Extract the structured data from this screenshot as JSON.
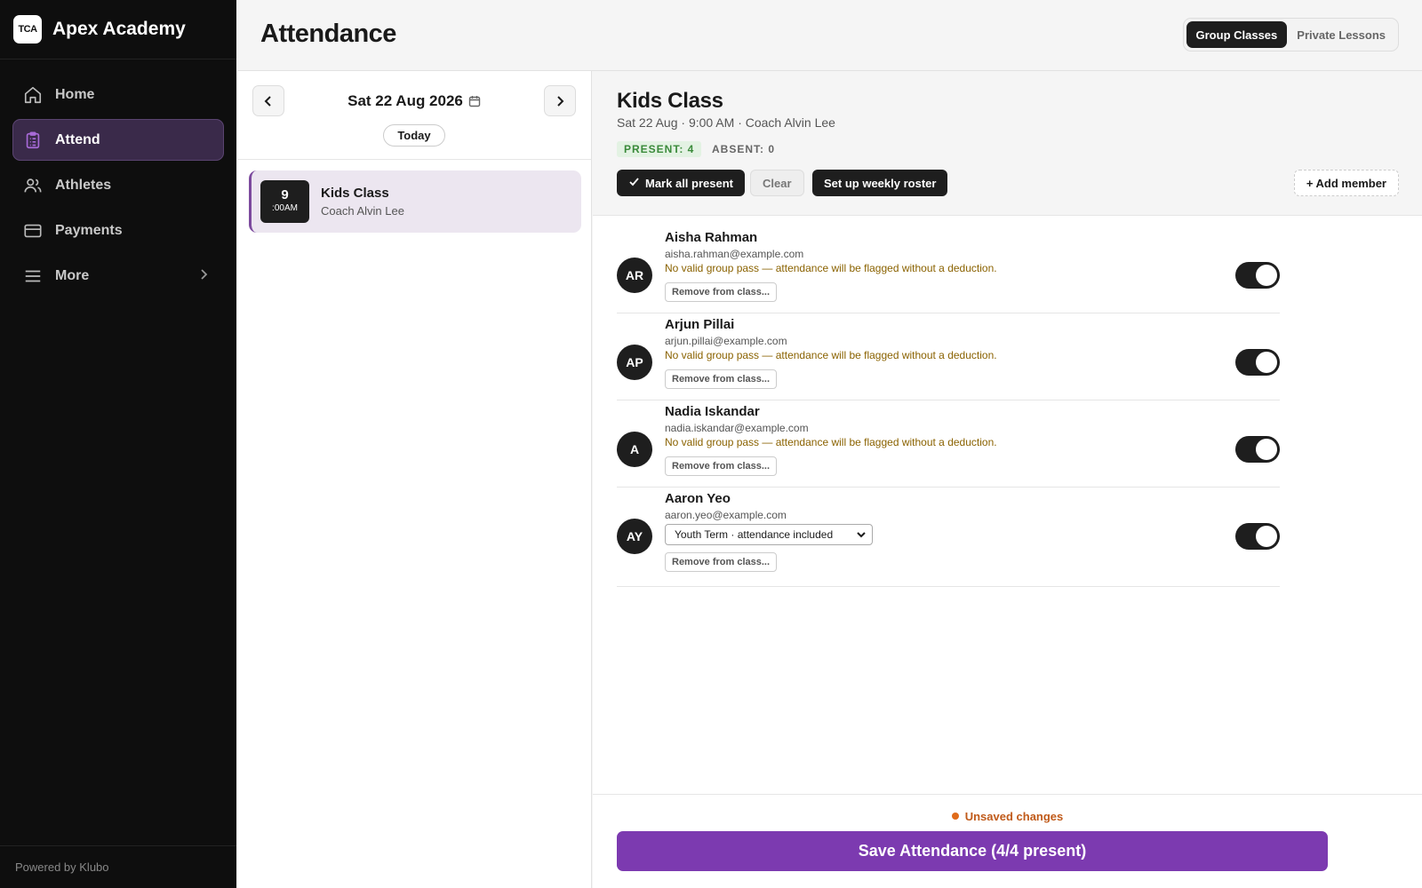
{
  "app": {
    "logo_text": "TCA",
    "name": "Apex Academy",
    "powered_by": "Powered by Klubo"
  },
  "sidebar": {
    "items": [
      {
        "label": "Home",
        "icon": "home-icon",
        "active": false
      },
      {
        "label": "Attend",
        "icon": "clipboard-icon",
        "active": true
      },
      {
        "label": "Athletes",
        "icon": "users-icon",
        "active": false
      },
      {
        "label": "Payments",
        "icon": "credit-card-icon",
        "active": false
      },
      {
        "label": "More",
        "icon": "menu-icon",
        "active": false
      }
    ]
  },
  "header": {
    "title": "Attendance",
    "tabs": [
      {
        "label": "Group Classes",
        "active": true
      },
      {
        "label": "Private Lessons",
        "active": false
      }
    ]
  },
  "schedule": {
    "date": "Sat 22 Aug 2026",
    "today_label": "Today",
    "classes": [
      {
        "hour": "9",
        "minutes": ":00AM",
        "title": "Kids Class",
        "coach": "Coach Alvin Lee"
      }
    ]
  },
  "session": {
    "title": "Kids Class",
    "meta": "Sat 22 Aug · 9:00 AM · Coach Alvin Lee",
    "present_label": "PRESENT: 4",
    "absent_label": "ABSENT: 0",
    "buttons": {
      "mark_all": "Mark all present",
      "clear": "Clear",
      "roster": "Set up weekly roster",
      "add_member": "+ Add member"
    }
  },
  "members": [
    {
      "initials": "AR",
      "name": "Aisha Rahman",
      "email": "aisha.rahman@example.com",
      "warning": "No valid group pass — attendance will be flagged without a deduction.",
      "remove_label": "Remove from class...",
      "present": true
    },
    {
      "initials": "AP",
      "name": "Arjun Pillai",
      "email": "arjun.pillai@example.com",
      "warning": "No valid group pass — attendance will be flagged without a deduction.",
      "remove_label": "Remove from class...",
      "present": true
    },
    {
      "initials": "A",
      "name": "Nadia Iskandar",
      "email": "nadia.iskandar@example.com",
      "warning": "No valid group pass — attendance will be flagged without a deduction.",
      "remove_label": "Remove from class...",
      "present": true
    },
    {
      "initials": "AY",
      "name": "Aaron Yeo",
      "email": "aaron.yeo@example.com",
      "pass_selected": "Youth Term · attendance included",
      "remove_label": "Remove from class...",
      "present": true
    }
  ],
  "footer": {
    "unsaved": "Unsaved changes",
    "save_label": "Save Attendance (4/4 present)"
  },
  "colors": {
    "accent": "#7c3ab0",
    "sidebar_bg": "#0e0e0e",
    "warning_text": "#8a6200",
    "present_green": "#3a8a3a"
  }
}
